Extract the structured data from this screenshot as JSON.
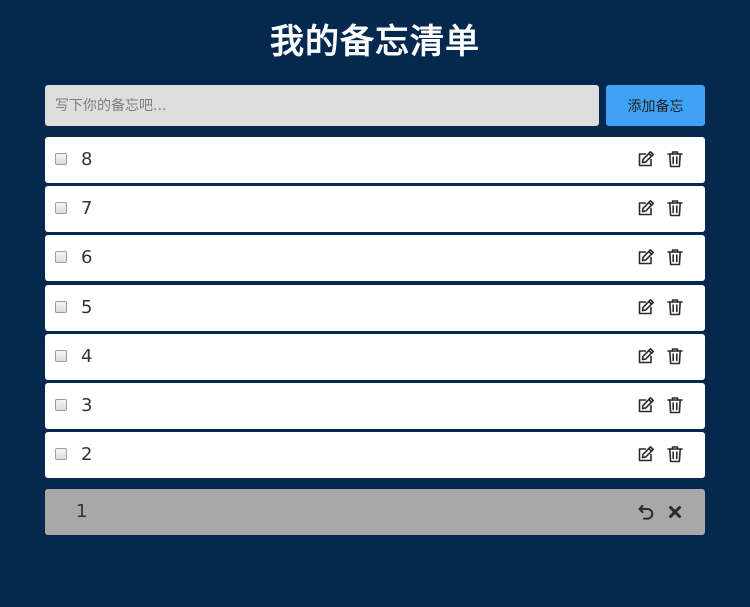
{
  "title": "我的备忘清单",
  "add_form": {
    "placeholder": "写下你的备忘吧...",
    "value": "",
    "button_label": "添加备忘"
  },
  "memos": [
    {
      "text": "8",
      "checked": false
    },
    {
      "text": "7",
      "checked": false
    },
    {
      "text": "6",
      "checked": false
    },
    {
      "text": "5",
      "checked": false
    },
    {
      "text": "4",
      "checked": false
    },
    {
      "text": "3",
      "checked": false
    },
    {
      "text": "2",
      "checked": false
    }
  ],
  "done": [
    {
      "text": "1"
    }
  ],
  "icons": {
    "edit": "edit-icon",
    "delete": "trash-icon",
    "undo": "undo-icon",
    "remove": "close-icon"
  },
  "colors": {
    "background": "#04284e",
    "accent_button": "#3fa2f7",
    "input_background": "#dededf",
    "item_background": "#ffffff",
    "done_background": "#a9a8a9"
  }
}
